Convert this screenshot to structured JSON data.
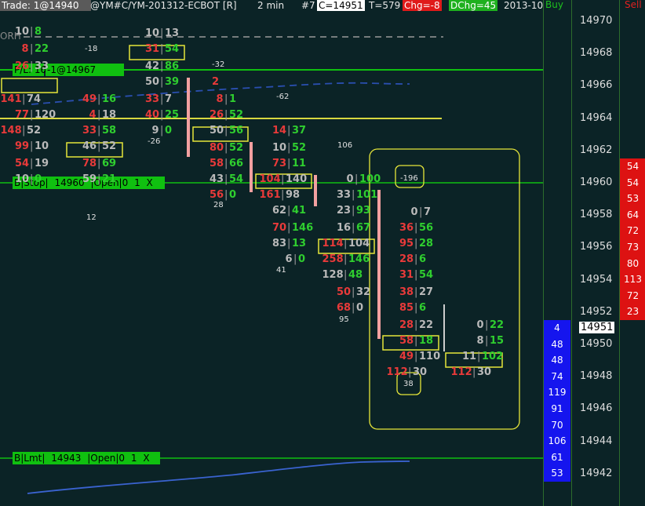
{
  "topbar": {
    "trade": "Trade: 1@14940",
    "instrument": "@YM#C/YM-201312-ECBOT [R]",
    "interval": "2 min",
    "bar_no": "#7",
    "close": "C=14951",
    "ticks": "T=579",
    "change": "Chg=-8",
    "daily_change": "DChg=45",
    "date": "2013-10"
  },
  "columns": {
    "buy": "Buy",
    "sell": "Sell"
  },
  "orh_label": "ORH",
  "price_axis": [
    "14970",
    "14968",
    "14966",
    "14964",
    "14962",
    "14960",
    "14958",
    "14956",
    "14954",
    "14952",
    "14950",
    "14948",
    "14946",
    "14944",
    "14942"
  ],
  "current_price": "14951",
  "buy_values": [
    "4",
    "48",
    "48",
    "74",
    "119",
    "91",
    "70",
    "106",
    "61",
    "53"
  ],
  "sell_values": [
    "54",
    "54",
    "53",
    "64",
    "72",
    "73",
    "80",
    "113",
    "72",
    "23"
  ],
  "pl_label": "P/L: 16P",
  "position_label": "-1@14967",
  "stop_order": {
    "type": "B|Stop|",
    "price": "14960",
    "status": "|Open|0",
    "qty": "1",
    "close": "X"
  },
  "limit_order": {
    "type": "B|Lmt|",
    "price": "14943",
    "status": "|Open|0",
    "qty": "1",
    "close": "X"
  },
  "bar_deltas": [
    "-18",
    "12",
    "-26",
    "-32",
    "28",
    "-62",
    "41",
    "106",
    "95",
    "-196",
    "38"
  ],
  "footprint_cells": [
    {
      "bid": "10",
      "ask": "8"
    },
    {
      "bid": "8",
      "ask": "22"
    },
    {
      "bid": "26",
      "ask": "33"
    },
    {
      "bid": "141",
      "ask": "74"
    },
    {
      "bid": "77",
      "ask": "120"
    },
    {
      "bid": "148",
      "ask": "52"
    },
    {
      "bid": "99",
      "ask": "10"
    },
    {
      "bid": "54",
      "ask": "19"
    },
    {
      "bid": "10",
      "ask": "0"
    },
    {
      "bid": "49",
      "ask": "16"
    },
    {
      "bid": "4",
      "ask": "18"
    },
    {
      "bid": "33",
      "ask": "58"
    },
    {
      "bid": "46",
      "ask": "52"
    },
    {
      "bid": "78",
      "ask": "69"
    },
    {
      "bid": "59",
      "ask": "21"
    },
    {
      "bid": "10",
      "ask": "13"
    },
    {
      "bid": "31",
      "ask": "54"
    },
    {
      "bid": "42",
      "ask": "86"
    },
    {
      "bid": "50",
      "ask": "39"
    },
    {
      "bid": "33",
      "ask": "7"
    },
    {
      "bid": "40",
      "ask": "25"
    },
    {
      "bid": "9",
      "ask": "0"
    },
    {
      "bid": "2",
      "ask": ""
    },
    {
      "bid": "8",
      "ask": "1"
    },
    {
      "bid": "26",
      "ask": "52"
    },
    {
      "bid": "50",
      "ask": "56"
    },
    {
      "bid": "80",
      "ask": "52"
    },
    {
      "bid": "58",
      "ask": "66"
    },
    {
      "bid": "43",
      "ask": "54"
    },
    {
      "bid": "56",
      "ask": "0"
    },
    {
      "bid": "14",
      "ask": "37"
    },
    {
      "bid": "10",
      "ask": "52"
    },
    {
      "bid": "73",
      "ask": "11"
    },
    {
      "bid": "104",
      "ask": "140"
    },
    {
      "bid": "161",
      "ask": "98"
    },
    {
      "bid": "62",
      "ask": "41"
    },
    {
      "bid": "70",
      "ask": "146"
    },
    {
      "bid": "83",
      "ask": "13"
    },
    {
      "bid": "6",
      "ask": "0"
    },
    {
      "bid": "0",
      "ask": "100"
    },
    {
      "bid": "33",
      "ask": "101"
    },
    {
      "bid": "23",
      "ask": "93"
    },
    {
      "bid": "16",
      "ask": "67"
    },
    {
      "bid": "114",
      "ask": "104"
    },
    {
      "bid": "258",
      "ask": "146"
    },
    {
      "bid": "128",
      "ask": "48"
    },
    {
      "bid": "50",
      "ask": "32"
    },
    {
      "bid": "68",
      "ask": "0"
    },
    {
      "bid": "0",
      "ask": "7"
    },
    {
      "bid": "36",
      "ask": "56"
    },
    {
      "bid": "95",
      "ask": "28"
    },
    {
      "bid": "28",
      "ask": "6"
    },
    {
      "bid": "31",
      "ask": "54"
    },
    {
      "bid": "38",
      "ask": "27"
    },
    {
      "bid": "85",
      "ask": "6"
    },
    {
      "bid": "28",
      "ask": "22"
    },
    {
      "bid": "58",
      "ask": "18"
    },
    {
      "bid": "49",
      "ask": "110"
    },
    {
      "bid": "112",
      "ask": "30"
    },
    {
      "bid": "0",
      "ask": "22"
    },
    {
      "bid": "8",
      "ask": "15"
    },
    {
      "bid": "11",
      "ask": "102"
    },
    {
      "bid": "112",
      "ask": "30"
    }
  ],
  "colors": {
    "background": "#0b2326",
    "bid": "#e83a3a",
    "ask": "#2fce2f",
    "neutral": "#b9b9b9",
    "highlight_box": "#e6e63a",
    "order_line": "#10c010",
    "ma_dashed": "#2a4fb0",
    "ma_solid": "#3a63d0",
    "buy_cell": "#1515ee",
    "sell_cell": "#dd1212"
  }
}
